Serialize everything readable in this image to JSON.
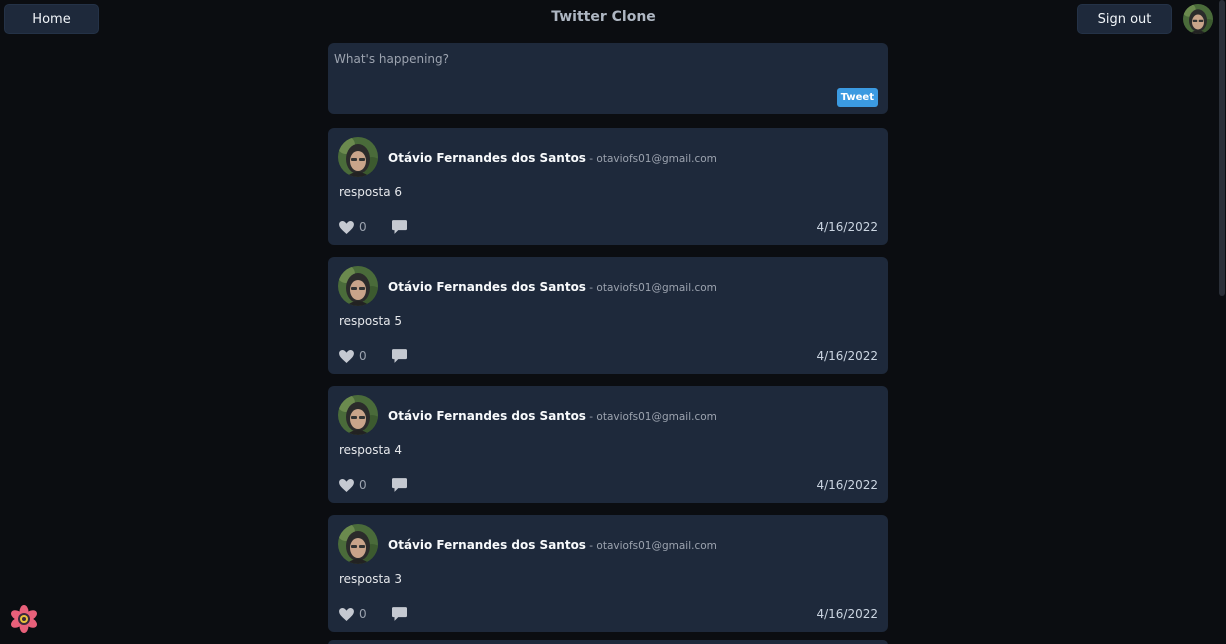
{
  "app": {
    "title": "Twitter Clone"
  },
  "header": {
    "home_label": "Home",
    "signout_label": "Sign out"
  },
  "composer": {
    "placeholder": "What's happening?",
    "tweet_label": "Tweet"
  },
  "posts": [
    {
      "name": "Otávio Fernandes dos Santos",
      "separator": " - ",
      "email": "otaviofs01@gmail.com",
      "content": "resposta 6",
      "likes": "0",
      "date": "4/16/2022"
    },
    {
      "name": "Otávio Fernandes dos Santos",
      "separator": " - ",
      "email": "otaviofs01@gmail.com",
      "content": "resposta 5",
      "likes": "0",
      "date": "4/16/2022"
    },
    {
      "name": "Otávio Fernandes dos Santos",
      "separator": " - ",
      "email": "otaviofs01@gmail.com",
      "content": "resposta 4",
      "likes": "0",
      "date": "4/16/2022"
    },
    {
      "name": "Otávio Fernandes dos Santos",
      "separator": " - ",
      "email": "otaviofs01@gmail.com",
      "content": "resposta 3",
      "likes": "0",
      "date": "4/16/2022"
    }
  ],
  "icons": {
    "like": "heart-icon",
    "comment": "comment-icon",
    "devtools": "react-devtools-icon"
  },
  "colors": {
    "background": "#0b0d11",
    "card": "#1e293b",
    "accent": "#3b9ae1"
  }
}
